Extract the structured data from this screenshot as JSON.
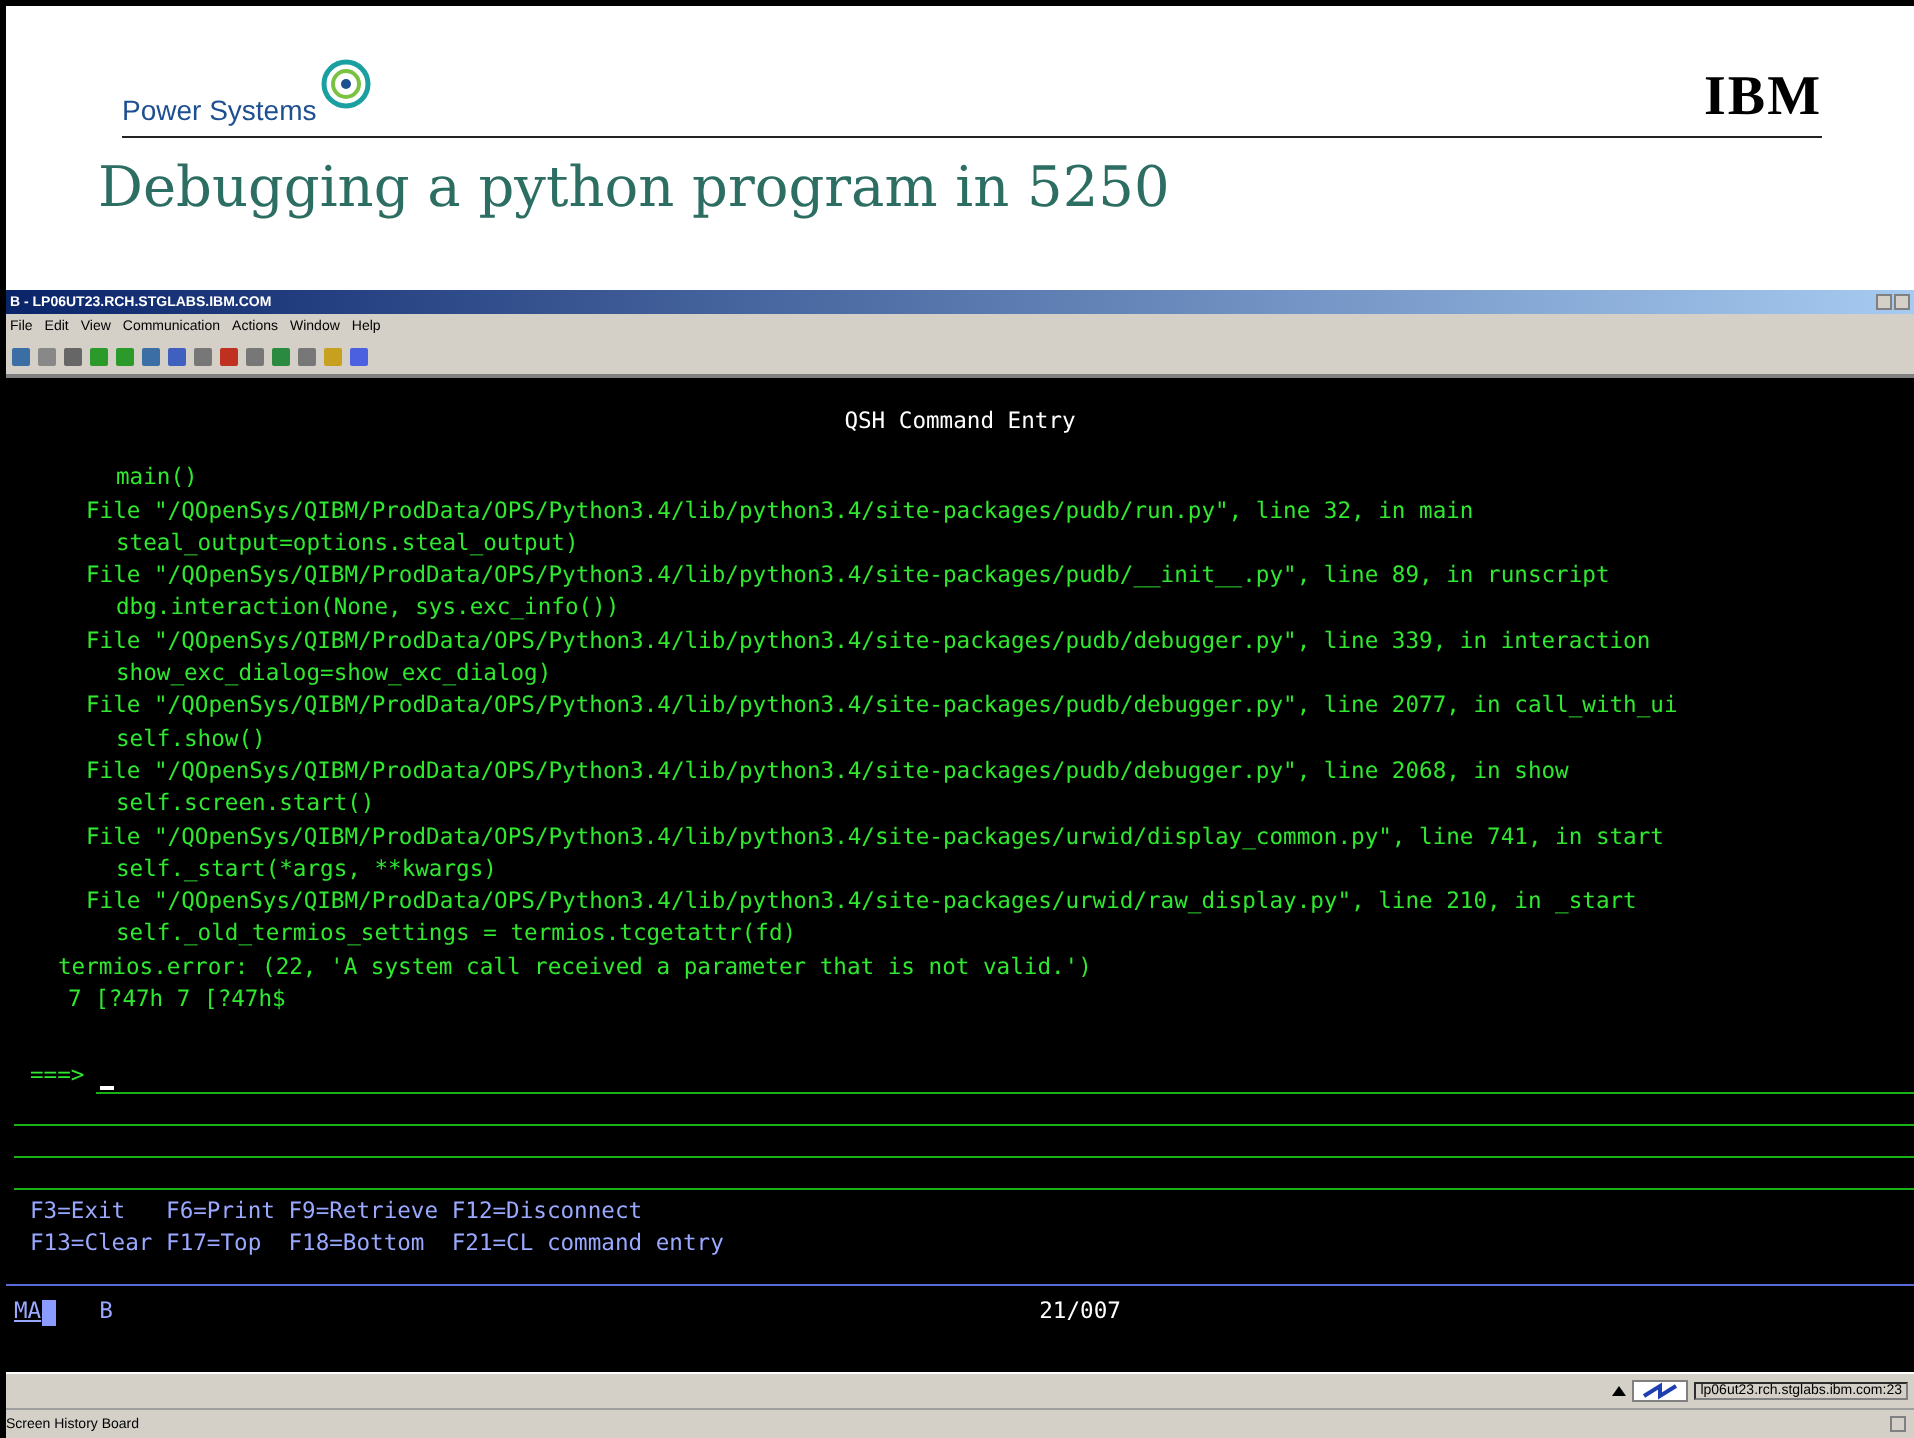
{
  "slide": {
    "brand": "Power Systems",
    "logo": "IBM",
    "title": "Debugging a python program in 5250"
  },
  "window": {
    "title": "B - LP06UT23.RCH.STGLABS.IBM.COM",
    "menu": [
      "File",
      "Edit",
      "View",
      "Communication",
      "Actions",
      "Window",
      "Help"
    ]
  },
  "terminal": {
    "heading": "QSH Command Entry",
    "output": [
      {
        "kind": "source",
        "text": "main()"
      },
      {
        "kind": "frame",
        "text": "File \"/QOpenSys/QIBM/ProdData/OPS/Python3.4/lib/python3.4/site-packages/pudb/run.py\", line 32, in main"
      },
      {
        "kind": "source",
        "text": "steal_output=options.steal_output)"
      },
      {
        "kind": "frame",
        "text": "File \"/QOpenSys/QIBM/ProdData/OPS/Python3.4/lib/python3.4/site-packages/pudb/__init__.py\", line 89, in runscript"
      },
      {
        "kind": "source",
        "text": "dbg.interaction(None, sys.exc_info())"
      },
      {
        "kind": "frame",
        "text": "File \"/QOpenSys/QIBM/ProdData/OPS/Python3.4/lib/python3.4/site-packages/pudb/debugger.py\", line 339, in interaction"
      },
      {
        "kind": "source",
        "text": "show_exc_dialog=show_exc_dialog)"
      },
      {
        "kind": "frame",
        "text": "File \"/QOpenSys/QIBM/ProdData/OPS/Python3.4/lib/python3.4/site-packages/pudb/debugger.py\", line 2077, in call_with_ui"
      },
      {
        "kind": "source",
        "text": "self.show()"
      },
      {
        "kind": "frame",
        "text": "File \"/QOpenSys/QIBM/ProdData/OPS/Python3.4/lib/python3.4/site-packages/pudb/debugger.py\", line 2068, in show"
      },
      {
        "kind": "source",
        "text": "self.screen.start()"
      },
      {
        "kind": "frame",
        "text": "File \"/QOpenSys/QIBM/ProdData/OPS/Python3.4/lib/python3.4/site-packages/urwid/display_common.py\", line 741, in start"
      },
      {
        "kind": "source",
        "text": "self._start(*args, **kwargs)"
      },
      {
        "kind": "frame",
        "text": "File \"/QOpenSys/QIBM/ProdData/OPS/Python3.4/lib/python3.4/site-packages/urwid/raw_display.py\", line 210, in _start"
      },
      {
        "kind": "source",
        "text": "self._old_termios_settings = termios.tcgetattr(fd)"
      },
      {
        "kind": "message",
        "text": "termios.error: (22, 'A system call received a parameter that is not valid.')"
      },
      {
        "kind": "raw",
        "text": "7 [?47h 7 [?47h$"
      }
    ],
    "prompt": "===>",
    "function_keys": [
      "F3=Exit   F6=Print F9=Retrieve F12=Disconnect",
      "F13=Clear F17=Top  F18=Bottom  F21=CL command entry"
    ],
    "status": {
      "mode": "MA",
      "session": "B",
      "position": "21/007"
    }
  },
  "status_bar": {
    "host": "lp06ut23.rch.stglabs.ibm.com:23",
    "label": "Screen History Board"
  }
}
